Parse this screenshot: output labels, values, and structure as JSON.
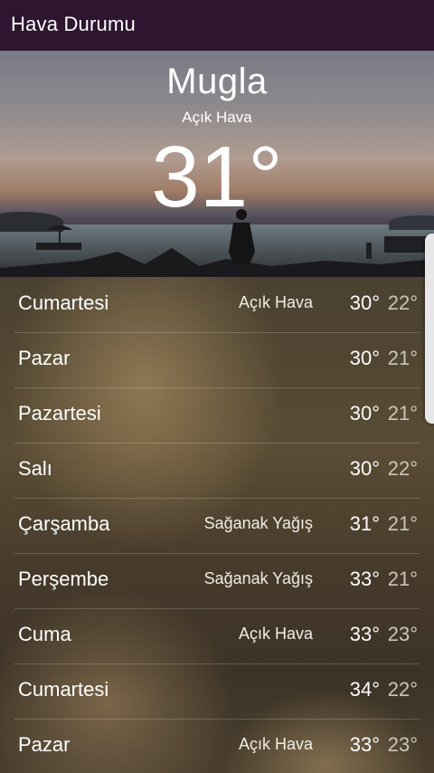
{
  "app": {
    "title": "Hava Durumu"
  },
  "current": {
    "city": "Mugla",
    "condition": "Açık Hava",
    "temperature": "31°"
  },
  "forecast": [
    {
      "day": "Cumartesi",
      "condition": "Açık Hava",
      "high": "30°",
      "low": "22°"
    },
    {
      "day": "Pazar",
      "condition": "",
      "high": "30°",
      "low": "21°"
    },
    {
      "day": "Pazartesi",
      "condition": "",
      "high": "30°",
      "low": "21°"
    },
    {
      "day": "Salı",
      "condition": "",
      "high": "30°",
      "low": "22°"
    },
    {
      "day": "Çarşamba",
      "condition": "Sağanak Yağış",
      "high": "31°",
      "low": "21°"
    },
    {
      "day": "Perşembe",
      "condition": "Sağanak Yağış",
      "high": "33°",
      "low": "21°"
    },
    {
      "day": "Cuma",
      "condition": "Açık Hava",
      "high": "33°",
      "low": "23°"
    },
    {
      "day": "Cumartesi",
      "condition": "",
      "high": "34°",
      "low": "22°"
    },
    {
      "day": "Pazar",
      "condition": "Açık Hava",
      "high": "33°",
      "low": "23°"
    }
  ]
}
